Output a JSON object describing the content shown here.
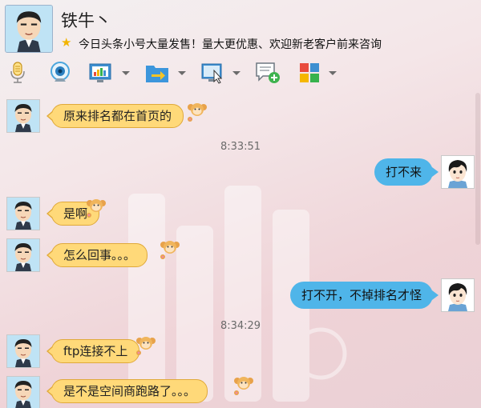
{
  "contact": {
    "name": "铁牛丶",
    "signature": "今日头条小号大量发售！量大更优惠、欢迎新老客户前来咨询"
  },
  "toolbar": {
    "icons": [
      "microphone-icon",
      "webcam-icon",
      "screen-share-icon",
      "file-transfer-icon",
      "remote-assist-icon",
      "add-comment-icon",
      "apps-grid-icon"
    ]
  },
  "messages": [
    {
      "side": "in",
      "text": "原来排名都在首页的"
    },
    {
      "time": "8:33:51"
    },
    {
      "side": "out",
      "text": "打不来"
    },
    {
      "side": "in",
      "text": "是啊"
    },
    {
      "side": "in",
      "text": "怎么回事。。。"
    },
    {
      "side": "out",
      "text": "打不开，不掉排名才怪"
    },
    {
      "time": "8:34:29"
    },
    {
      "side": "in",
      "text": "ftp连接不上"
    },
    {
      "side": "in",
      "text": "是不是空间商跑路了。。。"
    }
  ],
  "colors": {
    "incoming_bubble": "#ffd979",
    "outgoing_bubble": "#4fb5e9",
    "star": "#f2b400"
  }
}
